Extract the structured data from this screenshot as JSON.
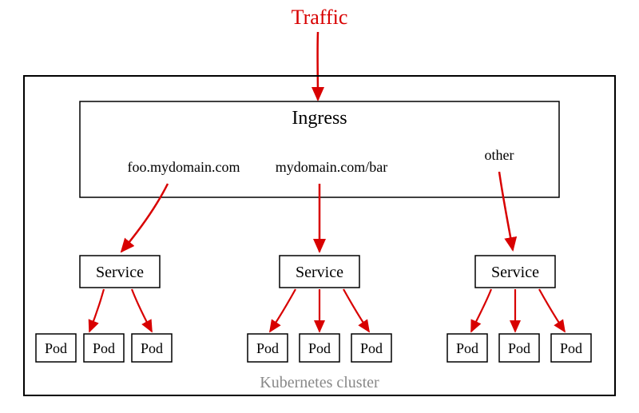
{
  "traffic_label": "Traffic",
  "ingress": {
    "title": "Ingress",
    "routes": [
      {
        "label": "foo.mydomain.com"
      },
      {
        "label": "mydomain.com/bar"
      },
      {
        "label": "other"
      }
    ]
  },
  "service_groups": [
    {
      "label": "Service",
      "pods": [
        "Pod",
        "Pod",
        "Pod"
      ]
    },
    {
      "label": "Service",
      "pods": [
        "Pod",
        "Pod",
        "Pod"
      ]
    },
    {
      "label": "Service",
      "pods": [
        "Pod",
        "Pod",
        "Pod"
      ]
    }
  ],
  "cluster_label": "Kubernetes cluster",
  "colors": {
    "arrow": "#d80000",
    "box": "#000000",
    "cluster_text": "#888888"
  }
}
